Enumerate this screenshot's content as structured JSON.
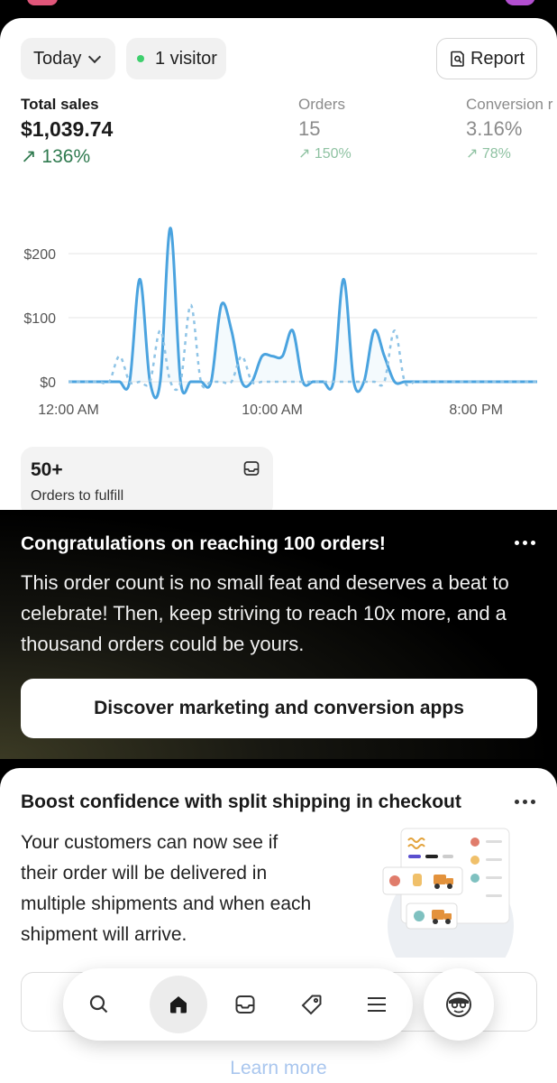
{
  "filters": {
    "date_label": "Today",
    "visitors_label": "1 visitor",
    "report_label": "Report"
  },
  "metrics": [
    {
      "label": "Total sales",
      "value": "$1,039.74",
      "change": "↗ 136%"
    },
    {
      "label": "Orders",
      "value": "15",
      "change": "↗ 150%"
    },
    {
      "label": "Conversion r",
      "value": "3.16%",
      "change": "↗ 78%"
    }
  ],
  "chart_data": {
    "type": "line",
    "y_ticks": [
      "$200",
      "$100",
      "$0"
    ],
    "x_ticks": [
      "12:00 AM",
      "10:00 AM",
      "8:00 PM"
    ],
    "ylim": [
      0,
      200
    ],
    "x": [
      0,
      1,
      1.5,
      2,
      2.5,
      3,
      3.5,
      4,
      4.5,
      5,
      5.5,
      6,
      6.5,
      7,
      7.5,
      8,
      8.5,
      9,
      9.5,
      10,
      10.5,
      11,
      11.5,
      12,
      12.5,
      13,
      13.5,
      14,
      14.5,
      15,
      15.5,
      16,
      16.5,
      17,
      17.5,
      18,
      18.5,
      19,
      19.5,
      20,
      20.5,
      21,
      21.5,
      22,
      22.5,
      23
    ],
    "series": [
      {
        "style": "solid",
        "color": "#4aa3df",
        "values": [
          0,
          0,
          0,
          0,
          0,
          0,
          160,
          0,
          0,
          240,
          0,
          0,
          0,
          0,
          120,
          80,
          0,
          0,
          40,
          40,
          40,
          80,
          0,
          0,
          0,
          0,
          160,
          0,
          0,
          80,
          40,
          0,
          0,
          0,
          0,
          0,
          0,
          0,
          0,
          0,
          0,
          0,
          0,
          0,
          0,
          0
        ]
      },
      {
        "style": "dashed",
        "color": "#8fc4e6",
        "values": [
          0,
          0,
          0,
          0,
          40,
          0,
          0,
          0,
          80,
          0,
          0,
          120,
          0,
          0,
          0,
          0,
          40,
          0,
          0,
          0,
          0,
          0,
          0,
          0,
          0,
          0,
          0,
          0,
          0,
          0,
          0,
          80,
          0,
          0,
          0,
          0,
          0,
          0,
          0,
          0,
          0,
          0,
          0,
          0,
          0,
          0
        ]
      }
    ],
    "grid": true
  },
  "fulfill": {
    "count": "50+",
    "label": "Orders to fulfill"
  },
  "milestone_card": {
    "title": "Congratulations on reaching 100 orders!",
    "body": "This order count is no small feat and deserves a beat to celebrate! Then, keep striving to reach 10x more, and a thousand orders could be yours.",
    "button_label": "Discover marketing and conversion apps"
  },
  "shipping_card": {
    "title": "Boost confidence with split shipping in checkout",
    "body": "Your customers can now see if their order will be delivered in multiple shipments and when each shipment will arrive.",
    "link_label": "Learn more"
  },
  "nav": {
    "items": [
      "search-icon",
      "home-icon",
      "inbox-icon",
      "tag-icon",
      "menu-icon"
    ],
    "account_icon": "store-avatar-icon"
  },
  "colors": {
    "accent_green": "#2f7a4f",
    "chart_blue": "#4aa3df",
    "link_blue": "#a9c6ee"
  }
}
